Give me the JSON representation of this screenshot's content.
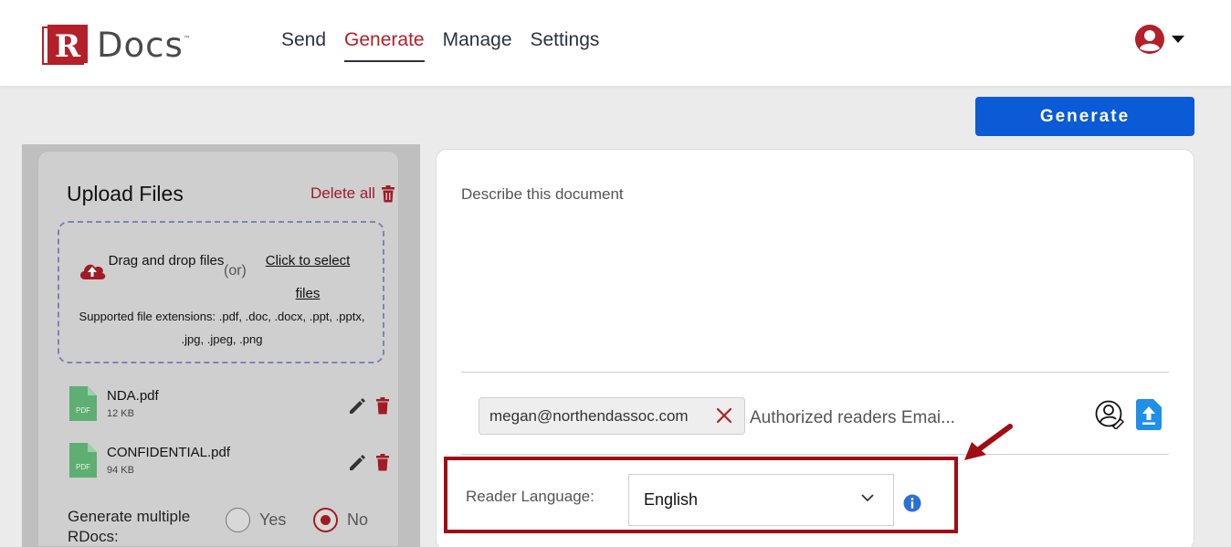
{
  "brand": {
    "name_r": "R",
    "name_rest": "Docs",
    "tm": "™",
    "color": "#b3202a"
  },
  "nav": [
    {
      "label": "Send",
      "active": false
    },
    {
      "label": "Generate",
      "active": true
    },
    {
      "label": "Manage",
      "active": false
    },
    {
      "label": "Settings",
      "active": false
    }
  ],
  "user_menu": {
    "icon": "account-circle-icon",
    "caret": "caret-down-icon"
  },
  "toolbar": {
    "generate_label": "Generate",
    "accent": "#0b5ad6"
  },
  "upload": {
    "title": "Upload Files",
    "delete_all_label": "Delete all",
    "drag_text": "Drag and drop files",
    "or_text": "(or)",
    "click_text": "Click to select files",
    "extensions_text": "Supported file extensions: .pdf, .doc, .docx, .ppt, .pptx, .jpg, .jpeg, .png",
    "files": [
      {
        "name": "NDA.pdf",
        "size": "12 KB",
        "icon_label": "PDF"
      },
      {
        "name": "CONFIDENTIAL.pdf",
        "size": "94 KB",
        "icon_label": "PDF"
      }
    ],
    "multiple_label": "Generate multiple RDocs:",
    "multiple_options": [
      {
        "label": "Yes",
        "checked": false
      },
      {
        "label": "No",
        "checked": true
      }
    ]
  },
  "document": {
    "describe_placeholder": "Describe this document",
    "readers": [
      "megan@northendassoc.com"
    ],
    "readers_placeholder": "Authorized readers Emai...",
    "reader_language_label": "Reader Language:",
    "reader_language_value": "English"
  },
  "annotation": {
    "color": "#a00d14"
  }
}
